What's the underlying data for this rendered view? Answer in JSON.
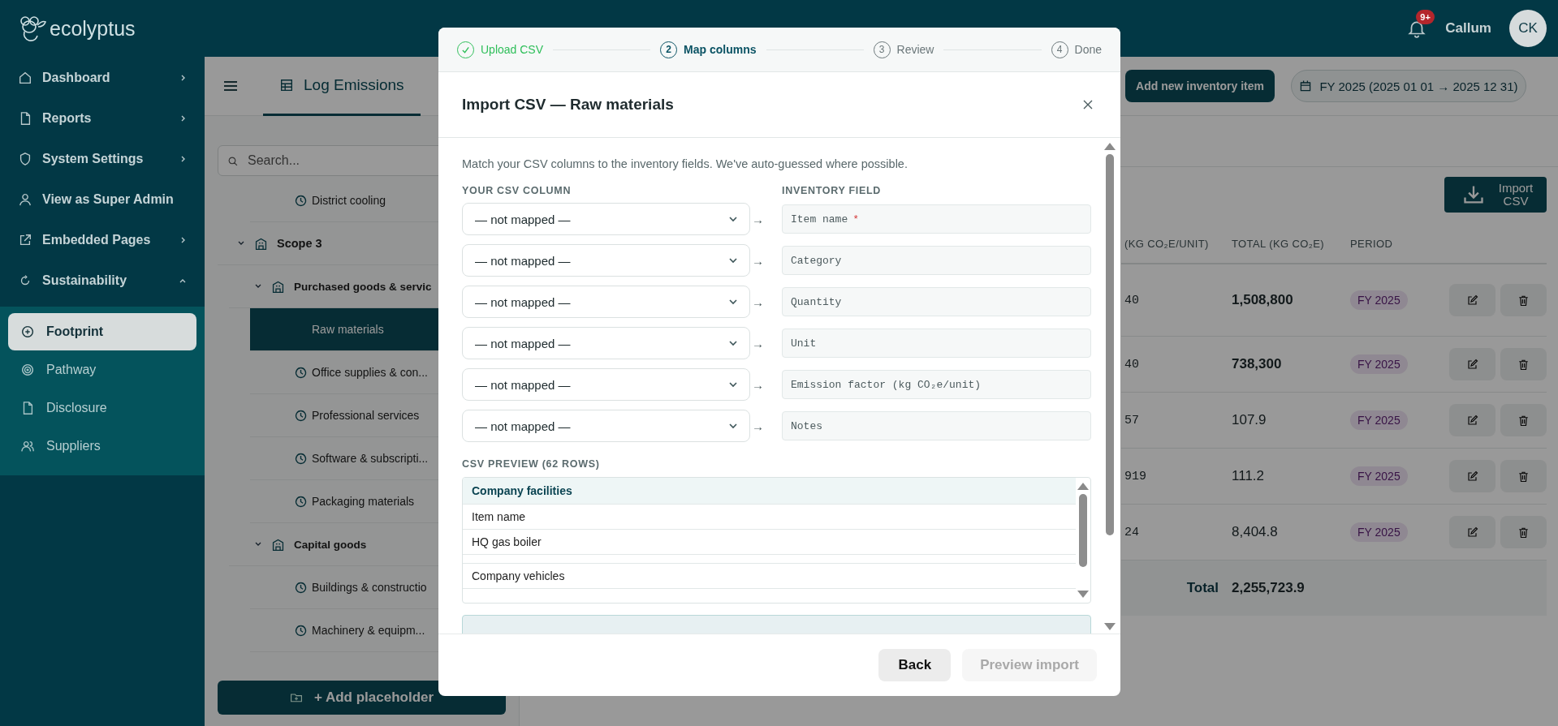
{
  "topbar": {
    "logo": "ecolyptus",
    "notification_badge": "9+",
    "user_name": "Callum",
    "avatar_initials": "CK"
  },
  "sidebar": {
    "items": [
      {
        "label": "Dashboard",
        "expanded": false
      },
      {
        "label": "Reports",
        "expanded": false
      },
      {
        "label": "System Settings",
        "expanded": false
      },
      {
        "label": "View as Super Admin"
      },
      {
        "label": "Embedded Pages",
        "expanded": false
      },
      {
        "label": "Sustainability",
        "expanded": true
      }
    ],
    "subitems": [
      {
        "label": "Footprint",
        "selected": true
      },
      {
        "label": "Pathway",
        "selected": false
      },
      {
        "label": "Disclosure",
        "selected": false
      },
      {
        "label": "Suppliers",
        "selected": false
      }
    ]
  },
  "toolbar": {
    "tabs": [
      {
        "label": "Log Emissions",
        "selected": true
      }
    ],
    "add_item_button": "Add new inventory item",
    "period_button": "FY 2025 (2025 01 01 → 2025 12 31)"
  },
  "tree": {
    "search_placeholder": "Search...",
    "items": [
      {
        "label": "District cooling",
        "selected": false
      },
      {
        "label": "Scope 3",
        "expanded": true,
        "children": [
          {
            "label": "Purchased goods & servic",
            "expanded": true,
            "children": [
              {
                "label": "Raw materials",
                "selected": true
              },
              {
                "label": "Office supplies & con...",
                "selected": false
              },
              {
                "label": "Professional services",
                "selected": false
              },
              {
                "label": "Software & subscripti...",
                "selected": false
              },
              {
                "label": "Packaging materials",
                "selected": false
              }
            ]
          },
          {
            "label": "Capital goods",
            "expanded": true,
            "children": [
              {
                "label": "Buildings & constructio",
                "selected": false
              },
              {
                "label": "Machinery & equipm...",
                "selected": false
              }
            ]
          }
        ]
      }
    ],
    "add_button": "+ Add placeholder"
  },
  "table": {
    "import_button": "Import CSV",
    "columns": [
      "(KG CO₂E/UNIT)",
      "TOTAL (KG CO₂E)",
      "PERIOD"
    ],
    "rows": [
      {
        "column_1": "40",
        "total": "1,508,800",
        "period": "FY 2025",
        "bold": true
      },
      {
        "column_1": "40",
        "total": "738,300",
        "period": "FY 2025",
        "bold": true
      },
      {
        "column_1": "57",
        "total": "107.9",
        "period": "FY 2025",
        "bold": false
      },
      {
        "column_1": "919",
        "total": "111.2",
        "period": "FY 2025",
        "bold": false
      },
      {
        "column_1": "24",
        "total": "8,404.8",
        "period": "FY 2025",
        "bold": false
      }
    ],
    "footer": {
      "label": "Total",
      "value": "2,255,723.9"
    }
  },
  "modal": {
    "steps": [
      {
        "label": "Upload CSV",
        "completed": true,
        "selected": false
      },
      {
        "number": "2",
        "label": "Map columns",
        "completed": false,
        "selected": true
      },
      {
        "number": "3",
        "label": "Review",
        "completed": false,
        "selected": false
      },
      {
        "number": "4",
        "label": "Done",
        "completed": false,
        "selected": false
      }
    ],
    "title": "Import CSV — Raw materials",
    "intro": "Match your CSV columns to the inventory fields. We've auto-guessed where possible.",
    "csv_column_heading": "YOUR CSV COLUMN",
    "field_heading": "INVENTORY FIELD",
    "mappings": [
      {
        "csv_column": "— not mapped —",
        "field": "Item name",
        "required": true
      },
      {
        "csv_column": "— not mapped —",
        "field": "Category",
        "required": false
      },
      {
        "csv_column": "— not mapped —",
        "field": "Quantity",
        "required": false
      },
      {
        "csv_column": "— not mapped —",
        "field": "Unit",
        "required": false
      },
      {
        "csv_column": "— not mapped —",
        "field": "Emission factor (kg CO₂e/unit)",
        "required": false
      },
      {
        "csv_column": "— not mapped —",
        "field": "Notes",
        "required": false
      }
    ],
    "arrow": "→",
    "required_mark": "*",
    "preview_heading": "CSV PREVIEW (62 ROWS)",
    "preview_rows": [
      {
        "text": "Company facilities",
        "kind": "group"
      },
      {
        "text": "Item name",
        "kind": "row"
      },
      {
        "text": "HQ gas boiler",
        "kind": "row"
      },
      {
        "kind": "blank"
      },
      {
        "text": "Company vehicles",
        "kind": "row"
      }
    ],
    "back_button": "Back",
    "preview_button": {
      "label": "Preview import",
      "disabled": true
    }
  }
}
